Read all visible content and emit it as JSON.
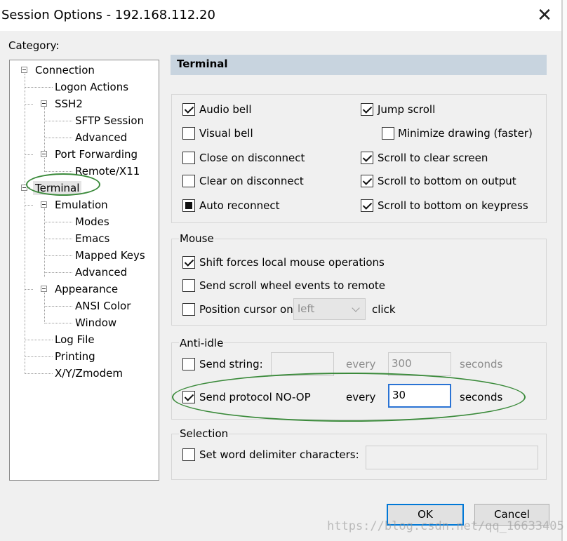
{
  "window": {
    "title": "Session Options - 192.168.112.20",
    "close_glyph": "✕"
  },
  "category_label": "Category:",
  "tree": {
    "connection": "Connection",
    "logon_actions": "Logon Actions",
    "ssh2": "SSH2",
    "sftp_session": "SFTP Session",
    "advanced_ssh2": "Advanced",
    "port_forwarding": "Port Forwarding",
    "remote_x11": "Remote/X11",
    "terminal": "Terminal",
    "emulation": "Emulation",
    "modes": "Modes",
    "emacs": "Emacs",
    "mapped_keys": "Mapped Keys",
    "advanced_emulation": "Advanced",
    "appearance": "Appearance",
    "ansi_color": "ANSI Color",
    "window": "Window",
    "log_file": "Log File",
    "printing": "Printing",
    "xyzmodem": "X/Y/Zmodem",
    "selected": "Terminal"
  },
  "section_title": "Terminal",
  "terminal_options": {
    "audio_bell": {
      "label": "Audio bell",
      "state": "checked"
    },
    "visual_bell": {
      "label": "Visual bell",
      "state": "unchecked"
    },
    "close_on_disconnect": {
      "label": "Close on disconnect",
      "state": "unchecked"
    },
    "clear_on_disconnect": {
      "label": "Clear on disconnect",
      "state": "unchecked"
    },
    "auto_reconnect": {
      "label": "Auto reconnect",
      "state": "indeterminate"
    },
    "jump_scroll": {
      "label": "Jump scroll",
      "state": "checked"
    },
    "minimize_drawing": {
      "label": "Minimize drawing (faster)",
      "state": "unchecked"
    },
    "scroll_to_clear": {
      "label": "Scroll to clear screen",
      "state": "checked"
    },
    "scroll_bottom_output": {
      "label": "Scroll to bottom on output",
      "state": "checked"
    },
    "scroll_bottom_keypress": {
      "label": "Scroll to bottom on keypress",
      "state": "checked"
    }
  },
  "mouse": {
    "group_label": "Mouse",
    "shift_forces": {
      "label": "Shift forces local mouse operations",
      "state": "checked"
    },
    "send_scroll": {
      "label": "Send scroll wheel events to remote",
      "state": "unchecked"
    },
    "position_cursor": {
      "label": "Position cursor on",
      "state": "unchecked"
    },
    "position_select_value": "left",
    "click_label": "click"
  },
  "anti_idle": {
    "group_label": "Anti-idle",
    "send_string": {
      "label": "Send string:",
      "state": "unchecked",
      "value": ""
    },
    "every_label_1": "every",
    "interval_1": "300",
    "seconds_label_1": "seconds",
    "send_noop": {
      "label": "Send protocol NO-OP",
      "state": "checked"
    },
    "every_label_2": "every",
    "interval_2": "30",
    "seconds_label_2": "seconds"
  },
  "selection": {
    "group_label": "Selection",
    "word_delimiters": {
      "label": "Set word delimiter characters:",
      "state": "unchecked",
      "value": ""
    }
  },
  "buttons": {
    "ok": "OK",
    "cancel": "Cancel"
  },
  "watermark": "https://blog.csdn.net/qq_16633405",
  "colors": {
    "annotation_ellipse": "#3a8a3a",
    "section_header_bg": "#c8d4df",
    "focus_border": "#2a73d4"
  }
}
